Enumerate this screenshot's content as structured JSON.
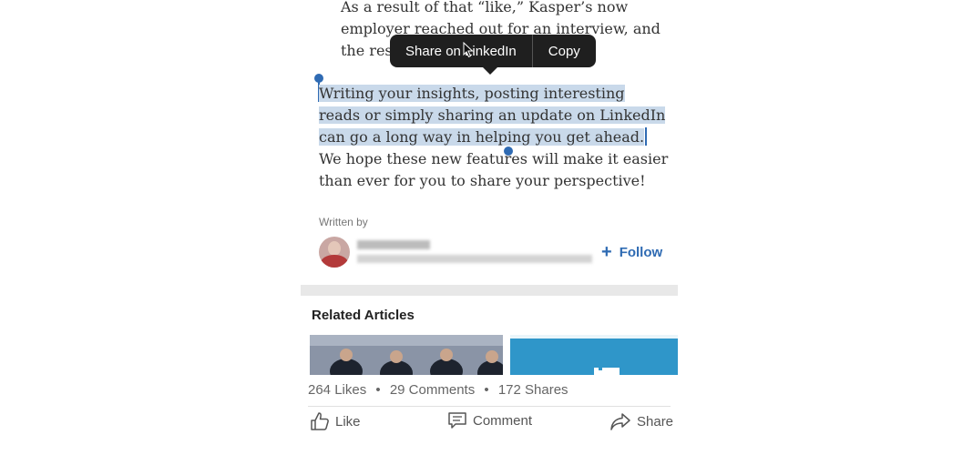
{
  "article": {
    "para1": "As a result of that “like,” Kasper’s now employer reached out for an interview, and the rest is history.",
    "para2_highlighted": "Writing your insights, posting interesting reads or simply sharing an update on LinkedIn can go a long way in helping you get ahead.",
    "para2_rest": " We hope these new features will make it easier than ever for you to share your perspective!"
  },
  "popup": {
    "share_label": "Share on LinkedIn",
    "copy_label": "Copy"
  },
  "author": {
    "written_by": "Written by",
    "follow_label": "Follow",
    "plus_icon": "+"
  },
  "related": {
    "title": "Related Articles"
  },
  "footer": {
    "likes": "264 Likes",
    "comments": "29 Comments",
    "shares": "172 Shares",
    "separator": "•",
    "like_label": "Like",
    "comment_label": "Comment",
    "share_label": "Share"
  },
  "colors": {
    "accent": "#2f6bb3",
    "highlight": "#c9d9ea",
    "popup_bg": "#1f1f1f"
  },
  "icons": [
    "cursor-icon",
    "plus-icon",
    "thumbs-up-icon",
    "comment-icon",
    "share-arrow-icon"
  ]
}
